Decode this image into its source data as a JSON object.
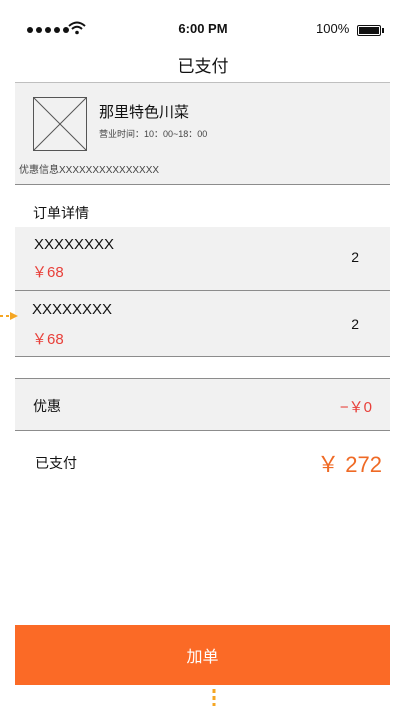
{
  "status_bar": {
    "time": "6:00 PM",
    "battery": "100%",
    "signal_icon": "signal-dots-icon",
    "wifi_icon": "wifi-icon",
    "battery_icon": "battery-icon"
  },
  "nav": {
    "title": "已支付"
  },
  "shop": {
    "image_icon": "image-placeholder-icon",
    "name": "那里特色川菜",
    "hours": "营业时间：10：00~18：00",
    "promo": "优惠信息XXXXXXXXXXXXXXX"
  },
  "order": {
    "section_title": "订单详情",
    "items": [
      {
        "name": "XXXXXXXX",
        "price": "￥68",
        "qty": "2"
      },
      {
        "name": "XXXXXXXX",
        "price": "￥68",
        "qty": "2"
      }
    ]
  },
  "discount": {
    "label": "优惠",
    "value": "−￥0"
  },
  "paid": {
    "label": "已支付",
    "value": "￥ 272"
  },
  "action": {
    "add_label": "加单"
  },
  "colors": {
    "accent": "#fb6a26",
    "price_red": "#e8403a",
    "total_orange": "#ef6a25",
    "annotation": "#f5a623"
  }
}
